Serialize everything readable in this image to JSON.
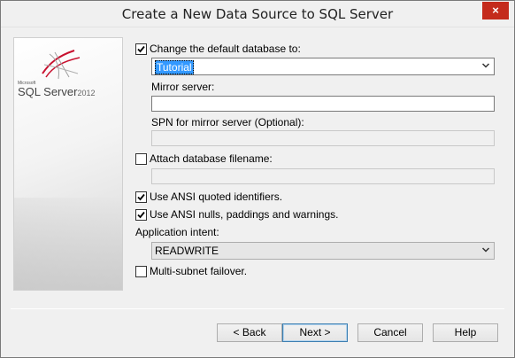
{
  "window": {
    "title": "Create a New Data Source to SQL Server",
    "close_glyph": "×"
  },
  "logo": {
    "microsoft": "Microsoft",
    "product": "SQL Server",
    "year": "2012"
  },
  "default_database": {
    "label": "Change the default database to:",
    "checked": true,
    "value": "Tutorial"
  },
  "mirror_server": {
    "label": "Mirror server:",
    "value": ""
  },
  "spn_mirror": {
    "label": "SPN for mirror server (Optional):",
    "value": ""
  },
  "attach_db": {
    "label": "Attach database filename:",
    "checked": false,
    "value": ""
  },
  "ansi_quoted": {
    "label": "Use ANSI quoted identifiers.",
    "checked": true
  },
  "ansi_nulls": {
    "label": "Use ANSI nulls, paddings and warnings.",
    "checked": true
  },
  "application_intent": {
    "label": "Application intent:",
    "value": "READWRITE"
  },
  "multi_subnet": {
    "label": "Multi-subnet failover.",
    "checked": false
  },
  "buttons": {
    "back": "< Back",
    "next": "Next >",
    "cancel": "Cancel",
    "help": "Help"
  },
  "colors": {
    "close_button": "#c42b1c",
    "selection": "#3399ff",
    "window_bg": "#f0f0f0"
  }
}
